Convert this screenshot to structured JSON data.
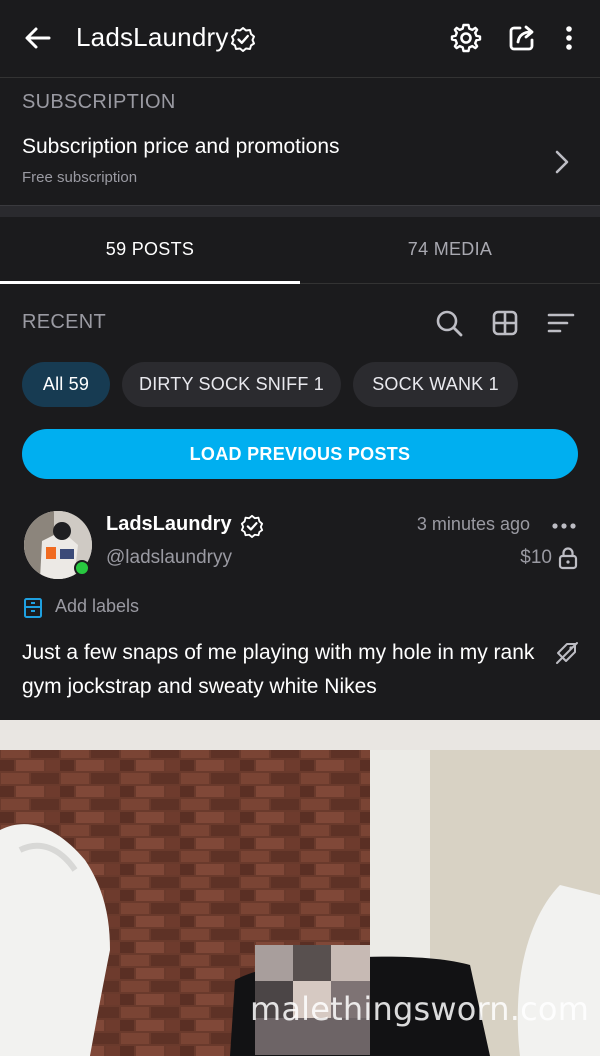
{
  "header": {
    "title": "LadsLaundry"
  },
  "subscription": {
    "heading": "SUBSCRIPTION",
    "price_label": "Subscription price and promotions",
    "free_label": "Free subscription"
  },
  "tabs": [
    {
      "label": "59 POSTS"
    },
    {
      "label": "74 MEDIA"
    }
  ],
  "recent": {
    "heading": "RECENT"
  },
  "chips": [
    {
      "label": "All 59"
    },
    {
      "label": "DIRTY SOCK SNIFF 1"
    },
    {
      "label": "SOCK WANK 1"
    }
  ],
  "load_button": "LOAD PREVIOUS POSTS",
  "post": {
    "name": "LadsLaundry",
    "handle": "@ladslaundryy",
    "time": "3 minutes ago",
    "price": "$10",
    "add_labels": "Add labels",
    "caption": "Just a few snaps of me playing with my hole in my rank gym jockstrap and sweaty white Nikes"
  },
  "watermark": "malethingsworn.com",
  "colors": {
    "background": "#1b1b1d",
    "accent": "#00aff0",
    "online": "#28c840"
  }
}
